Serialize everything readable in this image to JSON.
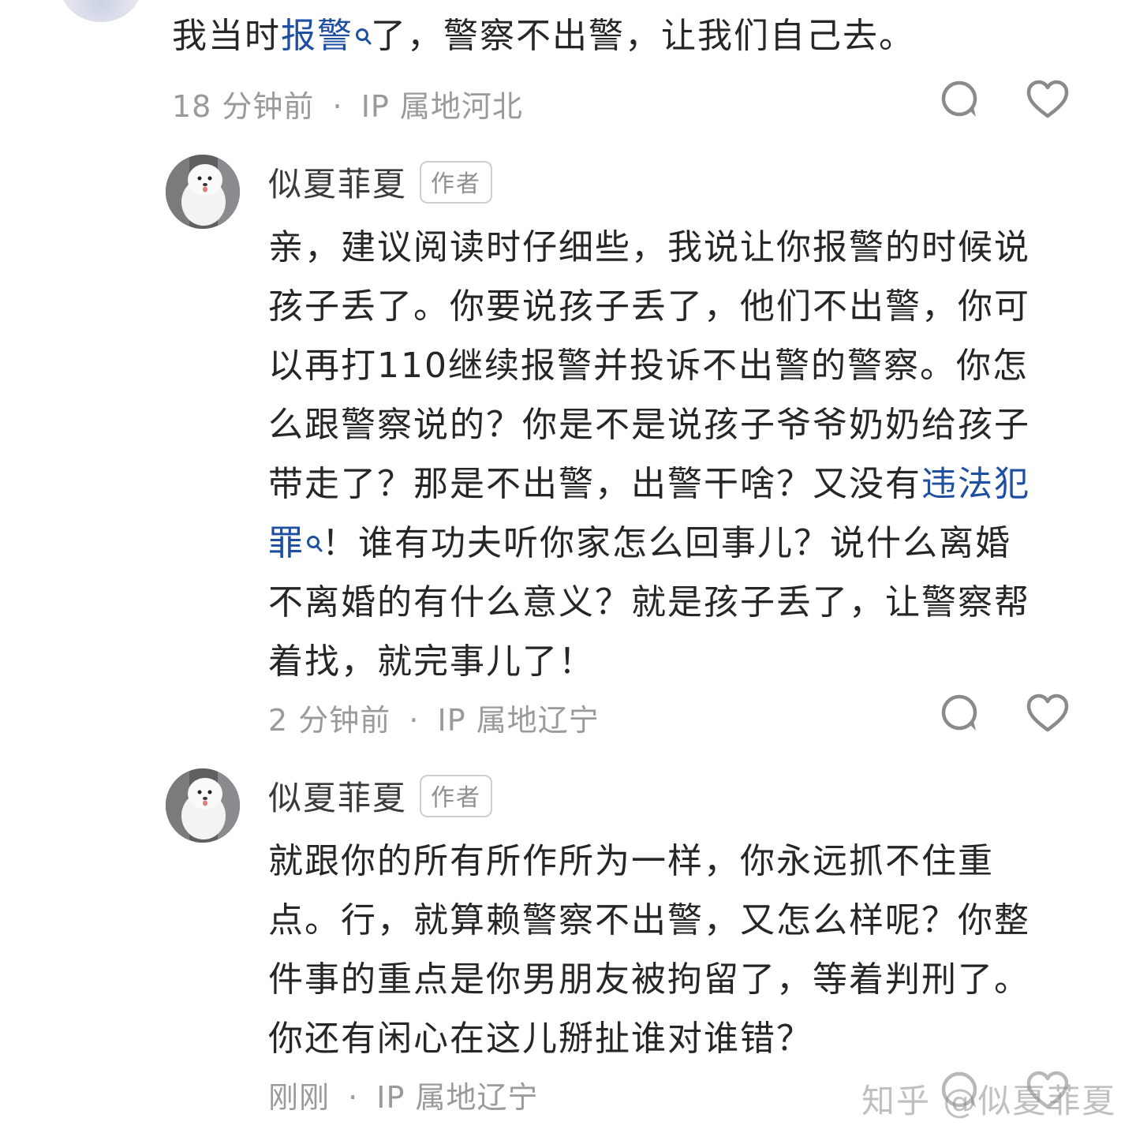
{
  "comment0": {
    "text_a": "我当时",
    "link": "报警",
    "text_b": "了，警察不出警，让我们自己去。",
    "time": "18 分钟前",
    "sep": "·",
    "ip": "IP 属地河北"
  },
  "reply1": {
    "author": "似夏菲夏",
    "badge": "作者",
    "lines": [
      "亲，建议阅读时仔细些，我说让你报警的时候说",
      "孩子丢了。你要说孩子丢了，他们不出警，你可",
      "以再打110继续报警并投诉不出警的警察。你怎",
      "么跟警察说的？你是不是说孩子爷爷奶奶给孩子"
    ],
    "line5_text": "带走了？那是不出警，出警干啥？又没有",
    "line5_link": "违法犯",
    "line6_link": "罪",
    "line6_text": "！谁有功夫听你家怎么回事儿？说什么离婚",
    "lines_tail": [
      "不离婚的有什么意义？就是孩子丢了，让警察帮",
      "着找，就完事儿了！"
    ],
    "time": "2 分钟前",
    "sep": "·",
    "ip": "IP 属地辽宁"
  },
  "reply2": {
    "author": "似夏菲夏",
    "badge": "作者",
    "lines": [
      "就跟你的所有所作所为一样，你永远抓不住重",
      "点。行，就算赖警察不出警，又怎么样呢？你整",
      "件事的重点是你男朋友被拘留了，等着判刑了。",
      "你还有闲心在这儿掰扯谁对谁错？"
    ],
    "time": "刚刚",
    "sep": "·",
    "ip": "IP 属地辽宁"
  },
  "watermark": "知乎 @似夏菲夏",
  "icons": {
    "reply": "comment-bubble-icon",
    "like": "heart-icon",
    "search": "search-icon"
  },
  "colors": {
    "link": "#1e4fa0",
    "meta": "#9a9a9a",
    "text": "#262626"
  }
}
